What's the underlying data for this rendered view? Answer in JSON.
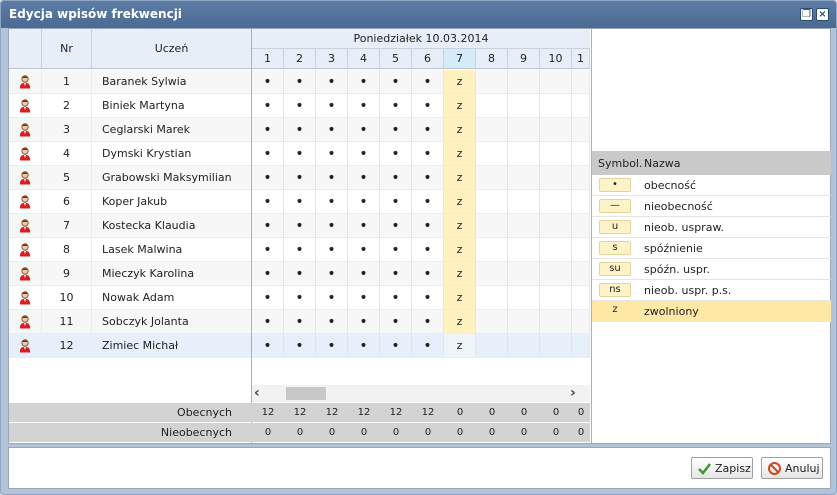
{
  "window": {
    "title": "Edycja wpisów frekwencji"
  },
  "table": {
    "headers": {
      "nr": "Nr",
      "student": "Uczeń",
      "day": "Poniedziałek 10.03.2014"
    },
    "lessons": [
      "1",
      "2",
      "3",
      "4",
      "5",
      "6",
      "7",
      "8",
      "9",
      "10",
      "1"
    ],
    "students": [
      {
        "nr": "1",
        "name": "Baranek Sylwia",
        "marks": [
          "•",
          "•",
          "•",
          "•",
          "•",
          "•",
          "z",
          "",
          "",
          "",
          ""
        ]
      },
      {
        "nr": "2",
        "name": "Biniek Martyna",
        "marks": [
          "•",
          "•",
          "•",
          "•",
          "•",
          "•",
          "z",
          "",
          "",
          "",
          ""
        ]
      },
      {
        "nr": "3",
        "name": "Ceglarski Marek",
        "marks": [
          "•",
          "•",
          "•",
          "•",
          "•",
          "•",
          "z",
          "",
          "",
          "",
          ""
        ]
      },
      {
        "nr": "4",
        "name": "Dymski Krystian",
        "marks": [
          "•",
          "•",
          "•",
          "•",
          "•",
          "•",
          "z",
          "",
          "",
          "",
          ""
        ]
      },
      {
        "nr": "5",
        "name": "Grabowski Maksymilian",
        "marks": [
          "•",
          "•",
          "•",
          "•",
          "•",
          "•",
          "z",
          "",
          "",
          "",
          ""
        ]
      },
      {
        "nr": "6",
        "name": "Koper Jakub",
        "marks": [
          "•",
          "•",
          "•",
          "•",
          "•",
          "•",
          "z",
          "",
          "",
          "",
          ""
        ]
      },
      {
        "nr": "7",
        "name": "Kostecka Klaudia",
        "marks": [
          "•",
          "•",
          "•",
          "•",
          "•",
          "•",
          "z",
          "",
          "",
          "",
          ""
        ]
      },
      {
        "nr": "8",
        "name": "Lasek Malwina",
        "marks": [
          "•",
          "•",
          "•",
          "•",
          "•",
          "•",
          "z",
          "",
          "",
          "",
          ""
        ]
      },
      {
        "nr": "9",
        "name": "Mieczyk Karolina",
        "marks": [
          "•",
          "•",
          "•",
          "•",
          "•",
          "•",
          "z",
          "",
          "",
          "",
          ""
        ]
      },
      {
        "nr": "10",
        "name": "Nowak Adam",
        "marks": [
          "•",
          "•",
          "•",
          "•",
          "•",
          "•",
          "z",
          "",
          "",
          "",
          ""
        ]
      },
      {
        "nr": "11",
        "name": "Sobczyk Jolanta",
        "marks": [
          "•",
          "•",
          "•",
          "•",
          "•",
          "•",
          "z",
          "",
          "",
          "",
          ""
        ]
      },
      {
        "nr": "12",
        "name": "Zimiec Michał",
        "marks": [
          "•",
          "•",
          "•",
          "•",
          "•",
          "•",
          "z",
          "",
          "",
          "",
          ""
        ]
      }
    ],
    "summary": {
      "present_label": "Obecnych",
      "absent_label": "Nieobecnych",
      "present": [
        "12",
        "12",
        "12",
        "12",
        "12",
        "12",
        "0",
        "0",
        "0",
        "0",
        "0"
      ],
      "absent": [
        "0",
        "0",
        "0",
        "0",
        "0",
        "0",
        "0",
        "0",
        "0",
        "0",
        "0"
      ]
    }
  },
  "legend": {
    "header_symbol": "Symbol.",
    "header_name": "Nazwa",
    "items": [
      {
        "symbol": "•",
        "name": "obecność"
      },
      {
        "symbol": "—",
        "name": "nieobecność"
      },
      {
        "symbol": "u",
        "name": "nieob. uspraw."
      },
      {
        "symbol": "s",
        "name": "spóźnienie"
      },
      {
        "symbol": "su",
        "name": "spóźn. uspr."
      },
      {
        "symbol": "ns",
        "name": "nieob. uspr. p.s."
      },
      {
        "symbol": "z",
        "name": "zwolniony"
      }
    ]
  },
  "buttons": {
    "save": "Zapisz",
    "cancel": "Anuluj"
  },
  "colors": {
    "titlebar": "#4a6a93",
    "exempt": "#fff2bf",
    "selected_row": "#e6f0fa"
  }
}
